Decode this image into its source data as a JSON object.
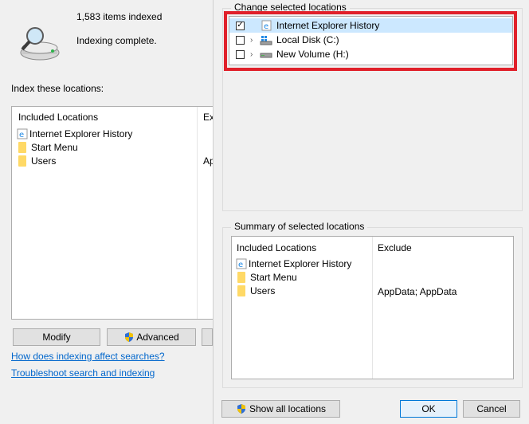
{
  "bg": {
    "items_indexed": "1,583 items indexed",
    "status": "Indexing complete.",
    "index_label": "Index these locations:",
    "table": {
      "col_included": "Included Locations",
      "col_exclude_partial": "Ex",
      "rows": [
        {
          "name": "Internet Explorer History",
          "exclude": ""
        },
        {
          "name": "Start Menu",
          "exclude": ""
        },
        {
          "name": "Users",
          "exclude": "Ap"
        }
      ]
    },
    "modify_label": "Modify",
    "advanced_label": "Advanced",
    "link_how": "How does indexing affect searches?",
    "link_troubleshoot": "Troubleshoot search and indexing"
  },
  "dialog": {
    "change_legend": "Change selected locations",
    "tree": [
      {
        "label": "Internet Explorer History",
        "checked": true
      },
      {
        "label": "Local Disk (C:)",
        "checked": false
      },
      {
        "label": "New Volume (H:)",
        "checked": false
      }
    ],
    "summary_legend": "Summary of selected locations",
    "summary": {
      "col_included": "Included Locations",
      "col_exclude": "Exclude",
      "rows": [
        {
          "name": "Internet Explorer History",
          "exclude": ""
        },
        {
          "name": "Start Menu",
          "exclude": ""
        },
        {
          "name": "Users",
          "exclude": "AppData; AppData"
        }
      ]
    },
    "show_all_label": "Show all locations",
    "ok_label": "OK",
    "cancel_label": "Cancel"
  },
  "colors": {
    "highlight": "#e0202a",
    "link": "#0066cc",
    "selection": "#cce8ff"
  }
}
